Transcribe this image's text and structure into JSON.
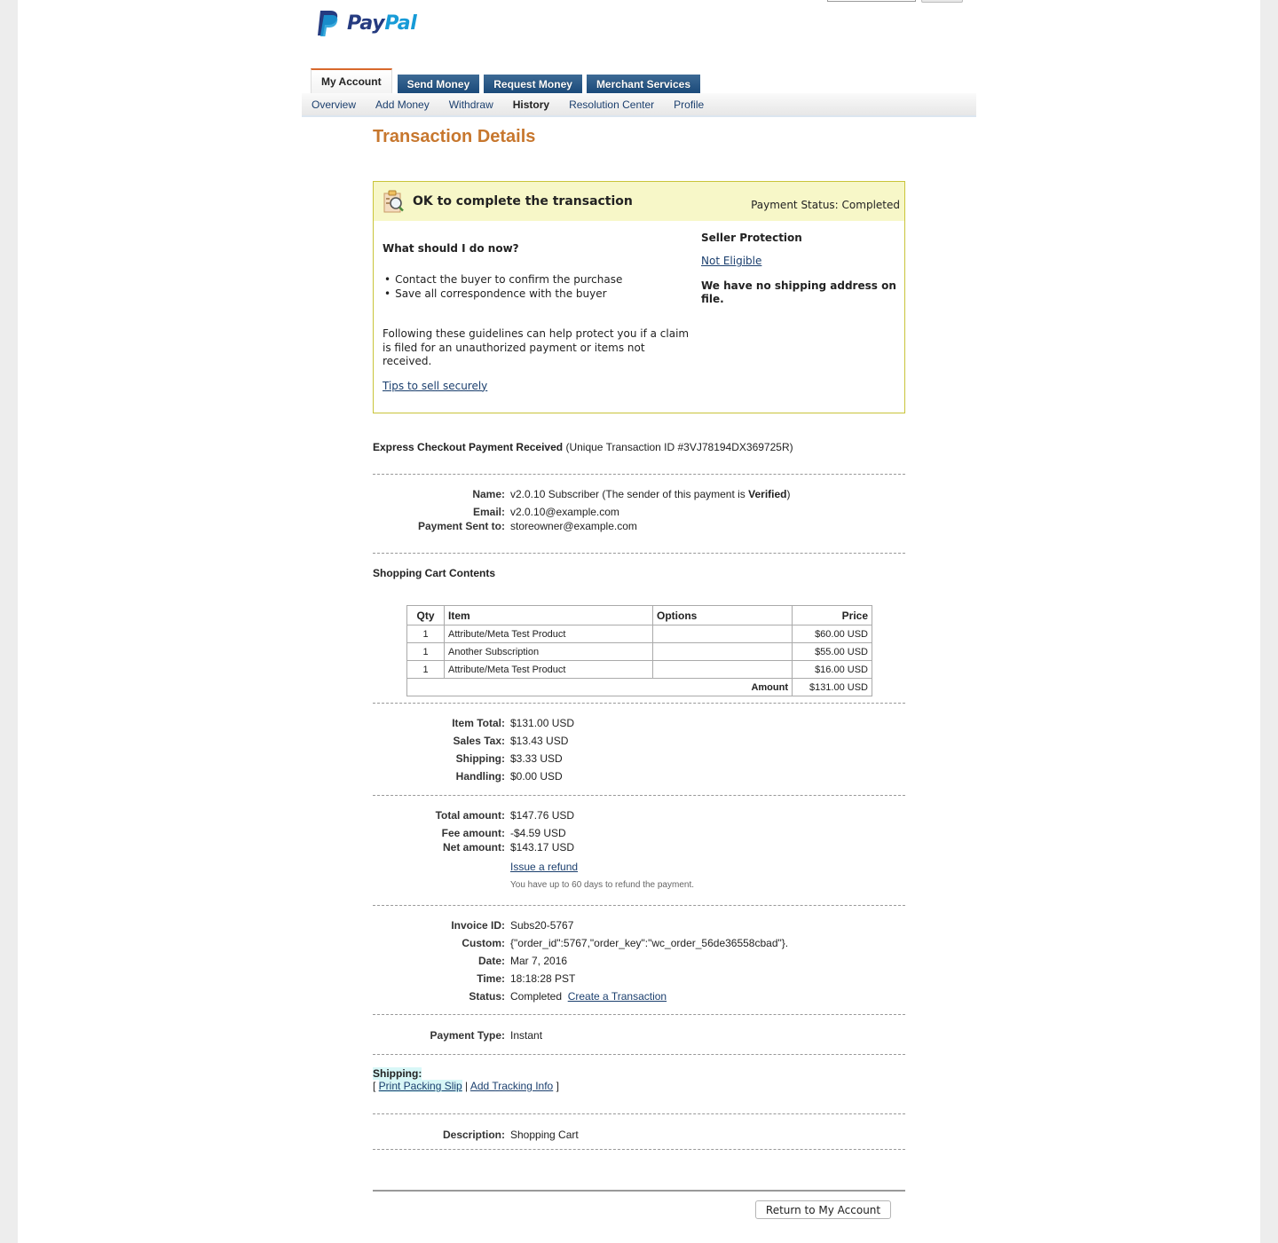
{
  "brand": {
    "pay": "Pay",
    "pal": "Pal",
    "colors": {
      "navy": "#253b80",
      "light": "#179bd7",
      "accent": "#c7772e"
    }
  },
  "tabs": [
    {
      "label": "My Account",
      "active": true
    },
    {
      "label": "Send Money"
    },
    {
      "label": "Request Money"
    },
    {
      "label": "Merchant Services"
    }
  ],
  "subnav": [
    {
      "label": "Overview"
    },
    {
      "label": "Add Money"
    },
    {
      "label": "Withdraw"
    },
    {
      "label": "History",
      "active": true
    },
    {
      "label": "Resolution Center"
    },
    {
      "label": "Profile"
    }
  ],
  "page_title": "Transaction Details",
  "alert": {
    "icon": "clipboard-magnifier-icon",
    "title": "OK to complete the transaction",
    "status": "Payment Status: Completed",
    "question": "What should I do now?",
    "bullets": [
      "Contact the buyer to confirm the purchase",
      "Save all correspondence with the buyer"
    ],
    "guideline": "Following these guidelines can help protect you if a claim is filed for an unauthorized payment or items not received.",
    "tips_link": "Tips to sell securely",
    "seller_protection_title": "Seller Protection",
    "seller_protection_value": "Not Eligible",
    "no_shipping": "We have no shipping address on file."
  },
  "transaction": {
    "type": "Express Checkout Payment Received",
    "id_text": "(Unique Transaction ID #3VJ78194DX369725R)"
  },
  "sender": {
    "name_label": "Name:",
    "name_value": "v2.0.10 Subscriber (The sender of this payment is ",
    "verified": "Verified",
    "name_suffix": ")",
    "email_label": "Email:",
    "email_value": "v2.0.10@example.com",
    "sent_to_label": "Payment Sent to:",
    "sent_to_value": "storeowner@example.com"
  },
  "cart": {
    "title": "Shopping Cart Contents",
    "headers": {
      "qty": "Qty",
      "item": "Item",
      "options": "Options",
      "price": "Price"
    },
    "rows": [
      {
        "qty": "1",
        "item": "Attribute/Meta Test Product",
        "options": "",
        "price": "$60.00 USD"
      },
      {
        "qty": "1",
        "item": "Another Subscription",
        "options": "",
        "price": "$55.00 USD"
      },
      {
        "qty": "1",
        "item": "Attribute/Meta Test Product",
        "options": "",
        "price": "$16.00 USD"
      }
    ],
    "amount_label": "Amount",
    "amount_value": "$131.00 USD"
  },
  "totals": [
    {
      "label": "Item Total:",
      "value": "$131.00 USD"
    },
    {
      "label": "Sales Tax:",
      "value": "$13.43 USD"
    },
    {
      "label": "Shipping:",
      "value": "$3.33 USD"
    },
    {
      "label": "Handling:",
      "value": "$0.00 USD"
    }
  ],
  "amounts": {
    "total_label": "Total amount:",
    "total_value": "$147.76 USD",
    "fee_label": "Fee amount:",
    "fee_value": "-$4.59 USD",
    "net_label": "Net amount:",
    "net_value": "$143.17 USD",
    "refund_link": "Issue a refund",
    "refund_note": "You have up to 60 days to refund the payment."
  },
  "info": {
    "invoice_label": "Invoice ID:",
    "invoice_value": "Subs20-5767",
    "custom_label": "Custom:",
    "custom_value": "{\"order_id\":5767,\"order_key\":\"wc_order_56de36558cbad\"}.",
    "date_label": "Date:",
    "date_value": "Mar 7, 2016",
    "time_label": "Time:",
    "time_value": "18:18:28 PST",
    "status_label": "Status:",
    "status_value": "Completed",
    "create_link": "Create a Transaction"
  },
  "payment_type": {
    "label": "Payment Type:",
    "value": "Instant"
  },
  "shipping": {
    "label": "Shipping:",
    "open": "[ ",
    "print_link": "Print Packing Slip",
    "sep": " | ",
    "tracking_link": "Add Tracking Info",
    "close": " ]"
  },
  "description": {
    "label": "Description:",
    "value": "Shopping Cart"
  },
  "return_button": "Return to My Account"
}
